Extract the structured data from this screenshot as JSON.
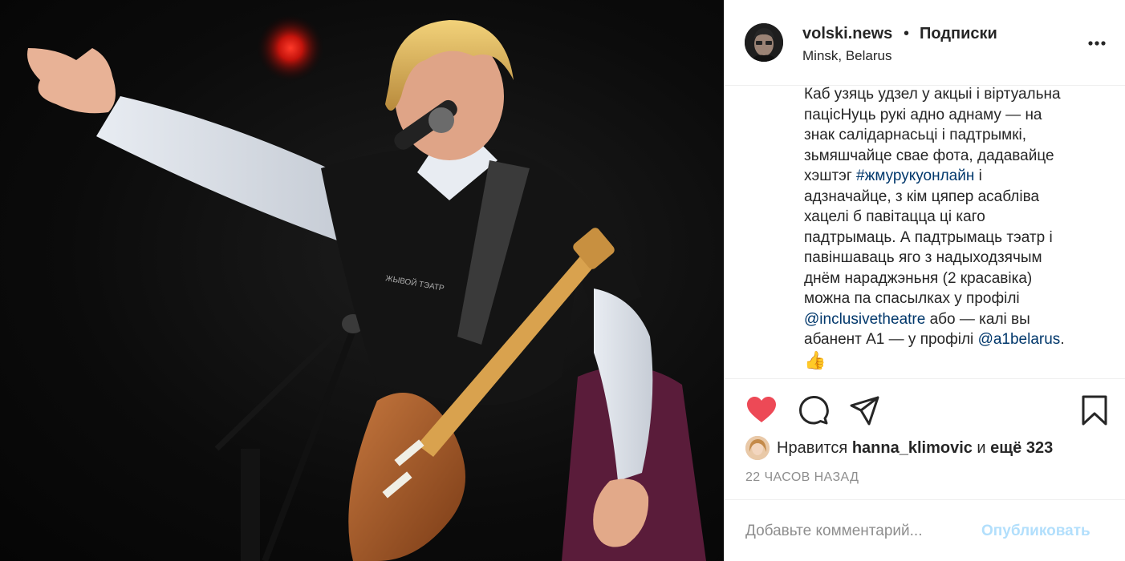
{
  "post": {
    "photo_alt": "Concert photo",
    "header": {
      "username": "volski.news",
      "separator": "•",
      "follow_label": "Подписки",
      "location": "Minsk, Belarus"
    },
    "caption": {
      "lines": [
        {
          "parts": [
            {
              "t": "Каб узяць удзел у акцыі і віртуальна"
            }
          ]
        },
        {
          "parts": [
            {
              "t": "пацісНуць рукі адно аднаму — на"
            }
          ]
        },
        {
          "parts": [
            {
              "t": "знак салідарнасьці і падтрымкі,"
            }
          ]
        },
        {
          "parts": [
            {
              "t": "зьмяшчайце свае фота, дадавайце"
            }
          ]
        },
        {
          "parts": [
            {
              "t": "хэштэг "
            },
            {
              "t": "#жмурукуонлайн",
              "link": true
            },
            {
              "t": " і"
            }
          ]
        },
        {
          "parts": [
            {
              "t": "адзначайце, з кім цяпер асабліва"
            }
          ]
        },
        {
          "parts": [
            {
              "t": "хацелі б павітацца ці каго"
            }
          ]
        },
        {
          "parts": [
            {
              "t": "падтрымаць. А падтрымаць тэатр і"
            }
          ]
        },
        {
          "parts": [
            {
              "t": "павіншаваць яго з надыходзячым"
            }
          ]
        },
        {
          "parts": [
            {
              "t": "днём нараджэньня (2 красавіка)"
            }
          ]
        },
        {
          "parts": [
            {
              "t": "можна па спасылках у профілі"
            }
          ]
        },
        {
          "parts": [
            {
              "t": "@inclusivetheatre",
              "link": true
            },
            {
              "t": " або — калі вы"
            }
          ]
        },
        {
          "parts": [
            {
              "t": "абанент А1 — у профілі "
            },
            {
              "t": "@a1belarus",
              "link": true
            },
            {
              "t": "."
            }
          ]
        },
        {
          "parts": [
            {
              "t": "👍",
              "emoji": true
            }
          ]
        }
      ]
    },
    "actions": {
      "like_icon": "heart-filled-icon",
      "comment_icon": "comment-icon",
      "share_icon": "share-icon",
      "save_icon": "bookmark-icon",
      "liked": true,
      "like_color": "#ed4956"
    },
    "likes": {
      "prefix": "Нравится ",
      "user": "hanna_klimovic",
      "middle": " и ",
      "others": "ещё 323"
    },
    "timestamp": "22 часов назад",
    "comment": {
      "placeholder": "Добавьте комментарий...",
      "publish_label": "Опубликовать"
    }
  }
}
